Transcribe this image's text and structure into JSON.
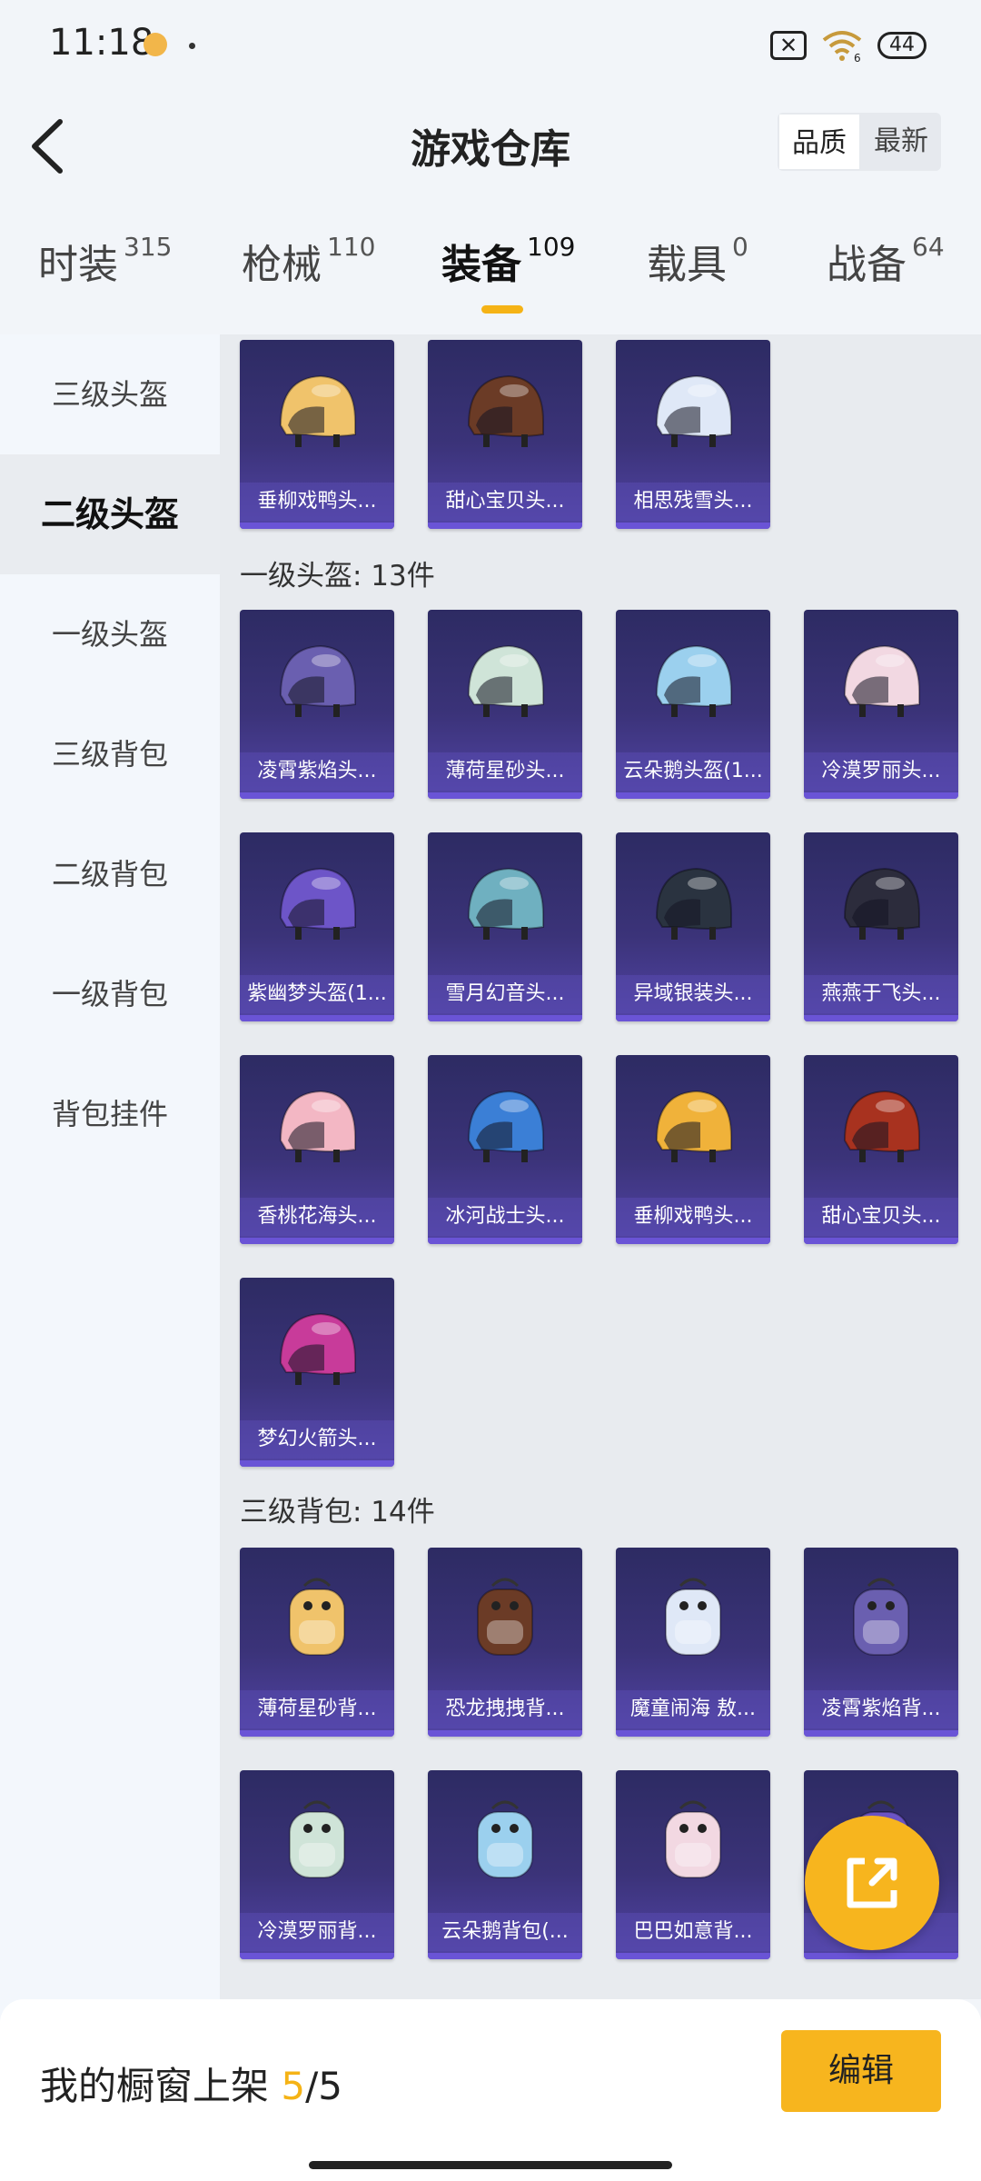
{
  "status_bar": {
    "time": "11:18",
    "signal": "6",
    "battery": "44"
  },
  "header": {
    "title": "游戏仓库",
    "sort": {
      "quality": "品质",
      "latest": "最新"
    }
  },
  "tabs": [
    {
      "label": "时装",
      "count": "315"
    },
    {
      "label": "枪械",
      "count": "110"
    },
    {
      "label": "装备",
      "count": "109"
    },
    {
      "label": "载具",
      "count": "0"
    },
    {
      "label": "战备",
      "count": "64"
    }
  ],
  "sidebar": [
    {
      "label": "三级头盔"
    },
    {
      "label": "二级头盔"
    },
    {
      "label": "一级头盔"
    },
    {
      "label": "三级背包"
    },
    {
      "label": "二级背包"
    },
    {
      "label": "一级背包"
    },
    {
      "label": "背包挂件"
    }
  ],
  "sections": {
    "level2_helmets": {
      "items": [
        "垂柳戏鸭头...",
        "甜心宝贝头...",
        "相思残雪头..."
      ]
    },
    "level1_helmets": {
      "title": "一级头盔: 13件",
      "items": [
        "凌霄紫焰头...",
        "薄荷星砂头...",
        "云朵鹅头盔(1...",
        "冷漠罗丽头...",
        "紫幽梦头盔(1...",
        "雪月幻音头...",
        "异域银装头...",
        "燕燕于飞头...",
        "香桃花海头...",
        "冰河战士头...",
        "垂柳戏鸭头...",
        "甜心宝贝头...",
        "梦幻火箭头..."
      ]
    },
    "level3_backpacks": {
      "title": "三级背包: 14件",
      "items": [
        "薄荷星砂背...",
        "恐龙拽拽背...",
        "魔童闹海 敖...",
        "凌霄紫焰背...",
        "冷漠罗丽背...",
        "云朵鹅背包(...",
        "巴巴如意背...",
        "..."
      ]
    }
  },
  "bottom_bar": {
    "label": "我的橱窗上架",
    "used": "5",
    "sep_total": "/5",
    "edit": "编辑"
  },
  "colors": {
    "accent": "#f7b51e",
    "card_top": "#2d2b63",
    "card_bottom": "#5244a6"
  }
}
